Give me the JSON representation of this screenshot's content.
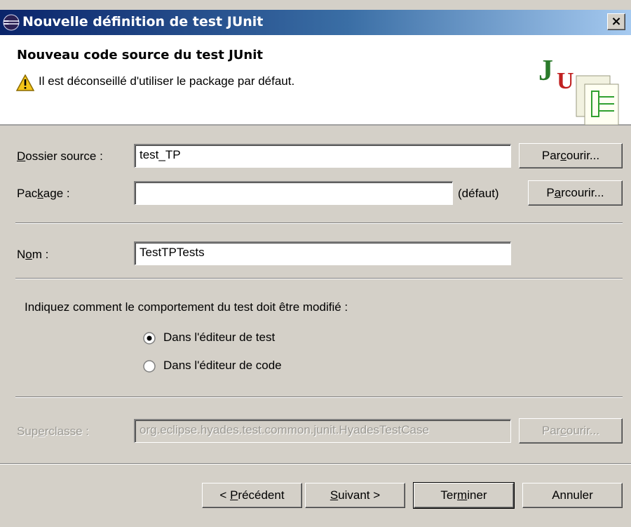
{
  "window": {
    "title": "Nouvelle définition de test JUnit",
    "close_label": "×"
  },
  "header": {
    "title": "Nouveau code source du test JUnit",
    "warning": "Il est déconseillé d'utiliser le package par défaut.",
    "logo_text": "JU"
  },
  "form": {
    "source_folder": {
      "label_pre": "",
      "label_key": "D",
      "label_post": "ossier source :",
      "value": "test_TP",
      "browse_pre": "Par",
      "browse_key": "c",
      "browse_post": "ourir..."
    },
    "package": {
      "label_pre": "Pac",
      "label_key": "k",
      "label_post": "age :",
      "value": "",
      "default_note": "(défaut)",
      "browse_pre": "P",
      "browse_key": "a",
      "browse_post": "rcourir..."
    },
    "name": {
      "label_pre": "N",
      "label_key": "o",
      "label_post": "m :",
      "value": "TestTPTests"
    },
    "behavior_prompt": "Indiquez comment le comportement du test doit être modifié :",
    "radios": [
      {
        "label": "Dans l'éditeur de test",
        "checked": true
      },
      {
        "label": "Dans l'éditeur de code",
        "checked": false
      }
    ],
    "superclass": {
      "label_pre": "Sup",
      "label_key": "e",
      "label_post": "rclasse :",
      "value": "org.eclipse.hyades.test.common.junit.HyadesTestCase",
      "browse_pre": "Par",
      "browse_key": "c",
      "browse_post": "ourir..."
    }
  },
  "buttons": {
    "back_pre": "< ",
    "back_key": "P",
    "back_post": "récédent",
    "next_pre": "",
    "next_key": "S",
    "next_post": "uivant >",
    "finish_pre": "Ter",
    "finish_key": "m",
    "finish_post": "iner",
    "cancel": "Annuler"
  },
  "colors": {
    "titlebar_start": "#0a246a",
    "titlebar_end": "#a6caf0",
    "dialog_bg": "#d4d0c8"
  }
}
